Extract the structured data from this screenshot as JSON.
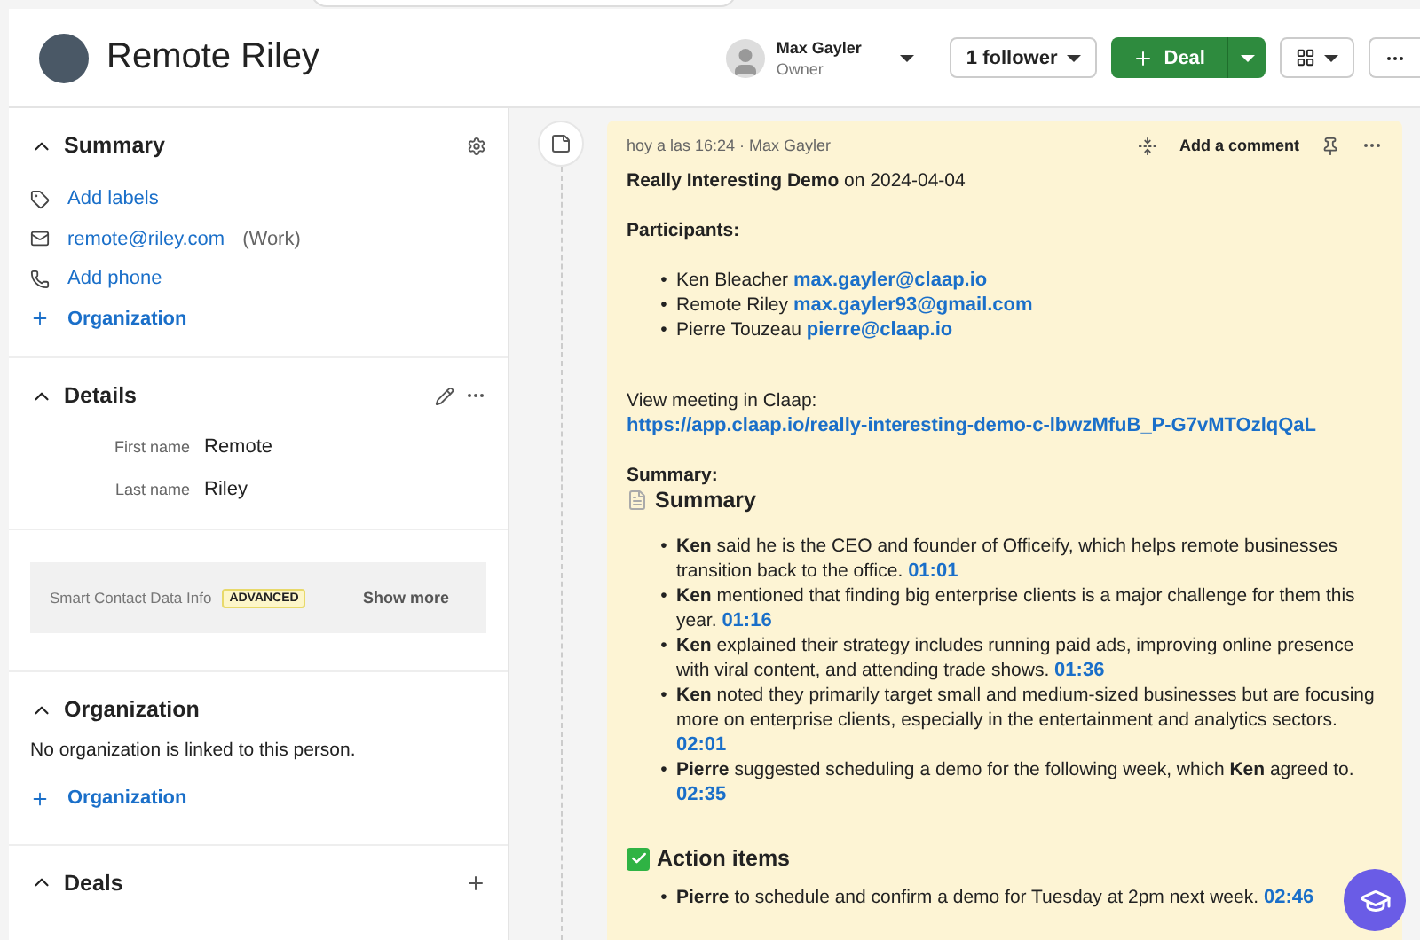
{
  "header": {
    "title": "Remote Riley",
    "owner": {
      "name": "Max Gayler",
      "role": "Owner"
    },
    "follower_button": "1 follower",
    "deal_button": "Deal"
  },
  "summary": {
    "title": "Summary",
    "expanded": true,
    "items": [
      {
        "kind": "labels",
        "label": "Add labels"
      },
      {
        "kind": "email",
        "label": "remote@riley.com",
        "note": "(Work)"
      },
      {
        "kind": "phone",
        "label": "Add phone"
      },
      {
        "kind": "add",
        "label": "Organization"
      }
    ]
  },
  "details": {
    "title": "Details",
    "expanded": true,
    "fields": [
      {
        "label": "First name",
        "value": "Remote"
      },
      {
        "label": "Last name",
        "value": "Riley"
      }
    ]
  },
  "smart_data": {
    "label": "Smart Contact Data Info",
    "badge": "ADVANCED",
    "action": "Show more"
  },
  "organization": {
    "title": "Organization",
    "expanded": true,
    "empty_text": "No organization is linked to this person.",
    "add_label": "Organization"
  },
  "deals": {
    "title": "Deals",
    "expanded": true
  },
  "note": {
    "meta": "hoy a las 16:24 · Max Gayler",
    "comment_button": "Add a comment",
    "title": "**Really Interesting Demo** on 2024-04-04",
    "bullet": "•",
    "participants_heading": "Participants:",
    "participants": [
      {
        "name": "Ken Bleacher",
        "email": "max.gayler@claap.io"
      },
      {
        "name": "Remote Riley",
        "email": "max.gayler93@gmail.com"
      },
      {
        "name": "Pierre Touzeau",
        "email": "pierre@claap.io"
      }
    ],
    "meeting_label": "View meeting in Claap:",
    "meeting_link": "https://app.claap.io/really-interesting-demo-c-lbwzMfuB_P-G7vMTOzlqQaL",
    "summary_label": "Summary:",
    "summary_heading": "Summary",
    "summary_points": [
      {
        "text": "**Ken** said he is the CEO and founder of Officeify, which helps remote businesses transition back to the office.",
        "time": "01:01"
      },
      {
        "text": "**Ken** mentioned that finding big enterprise clients is a major challenge for them this year.",
        "time": "01:16"
      },
      {
        "text": "**Ken** explained their strategy includes running paid ads, improving online presence with viral content, and attending trade shows.",
        "time": "01:36"
      },
      {
        "text": "**Ken** noted they primarily target small and medium-sized businesses but are focusing more on enterprise clients, especially in the entertainment and analytics sectors.",
        "time": "02:01"
      },
      {
        "text": "**Pierre** suggested scheduling a demo for the following week, which **Ken** agreed to.",
        "time": "02:35"
      }
    ],
    "action_heading": "Action items",
    "action_points": [
      {
        "text": "**Pierre** to schedule and confirm a demo for Tuesday at 2pm next week.",
        "time": "02:46"
      }
    ]
  }
}
